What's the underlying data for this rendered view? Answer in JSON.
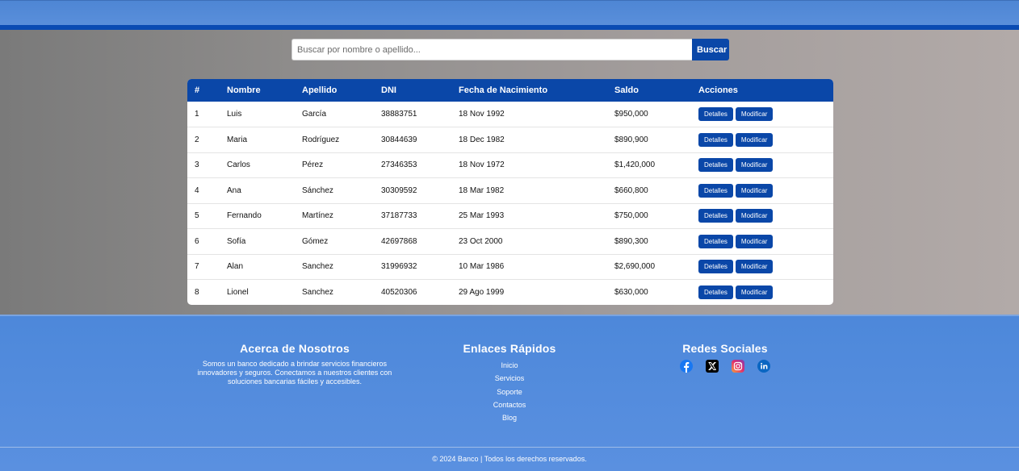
{
  "search": {
    "placeholder": "Buscar por nombre o apellido...",
    "button_label": "Buscar"
  },
  "table": {
    "headers": [
      "#",
      "Nombre",
      "Apellido",
      "DNI",
      "Fecha de Nacimiento",
      "Saldo",
      "Acciones"
    ],
    "actions": {
      "details_label": "Detalles",
      "modify_label": "Modificar"
    },
    "rows": [
      {
        "num": "1",
        "nombre": "Luis",
        "apellido": "García",
        "dni": "38883751",
        "fecha": "18 Nov 1992",
        "saldo": "$950,000"
      },
      {
        "num": "2",
        "nombre": "Maria",
        "apellido": "Rodríguez",
        "dni": "30844639",
        "fecha": "18 Dec 1982",
        "saldo": "$890,900"
      },
      {
        "num": "3",
        "nombre": "Carlos",
        "apellido": "Pérez",
        "dni": "27346353",
        "fecha": "18 Nov 1972",
        "saldo": "$1,420,000"
      },
      {
        "num": "4",
        "nombre": "Ana",
        "apellido": "Sánchez",
        "dni": "30309592",
        "fecha": "18 Mar 1982",
        "saldo": "$660,800"
      },
      {
        "num": "5",
        "nombre": "Fernando",
        "apellido": "Martínez",
        "dni": "37187733",
        "fecha": "25 Mar 1993",
        "saldo": "$750,000"
      },
      {
        "num": "6",
        "nombre": "Sofía",
        "apellido": "Gómez",
        "dni": "42697868",
        "fecha": "23 Oct 2000",
        "saldo": "$890,300"
      },
      {
        "num": "7",
        "nombre": "Alan",
        "apellido": "Sanchez",
        "dni": "31996932",
        "fecha": "10 Mar 1986",
        "saldo": "$2,690,000"
      },
      {
        "num": "8",
        "nombre": "Lionel",
        "apellido": "Sanchez",
        "dni": "40520306",
        "fecha": "29 Ago 1999",
        "saldo": "$630,000"
      }
    ]
  },
  "footer": {
    "about_title": "Acerca de Nosotros",
    "about_text": "Somos un banco dedicado a brindar servicios financieros innovadores y seguros. Conectamos a nuestros clientes con soluciones bancarias fáciles y accesibles.",
    "links_title": "Enlaces Rápidos",
    "links": [
      "Inicio",
      "Servicios",
      "Soporte",
      "Contactos",
      "Blog"
    ],
    "social_title": "Redes Sociales",
    "social_icons": [
      "facebook-icon",
      "x-icon",
      "instagram-icon",
      "linkedin-icon"
    ],
    "copyright": "© 2024 Banco | Todos los derechos reservados."
  },
  "colors": {
    "primary": "#0a47a8",
    "footer_bg": "#5a90e0",
    "topbar": "#4e86d4"
  }
}
